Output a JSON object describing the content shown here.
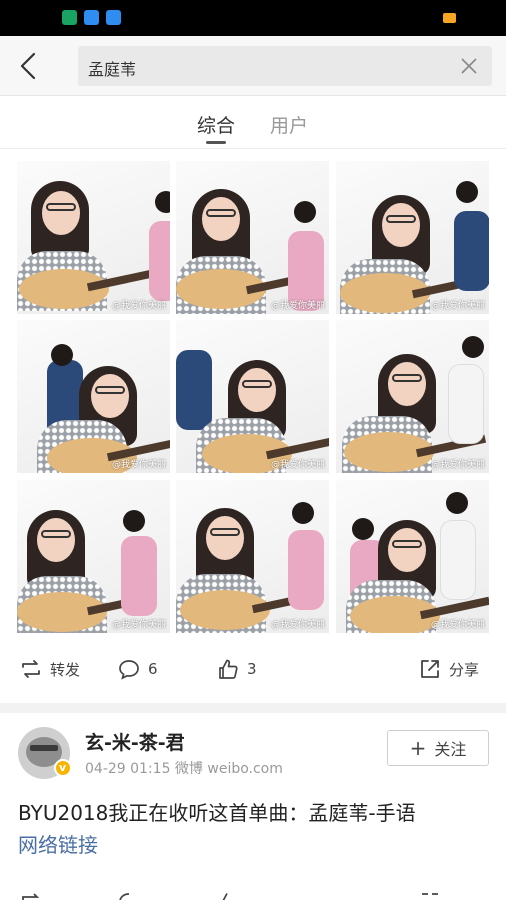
{
  "search": {
    "query": "孟庭苇"
  },
  "tabs": [
    {
      "label": "综合",
      "active": true
    },
    {
      "label": "用户",
      "active": false
    }
  ],
  "photos": [
    {
      "watermark": "@我爱你美丽"
    },
    {
      "watermark": "@我爱你美丽"
    },
    {
      "watermark": "@我爱你美丽"
    },
    {
      "watermark": "@我爱你美丽"
    },
    {
      "watermark": "@我爱你美丽"
    },
    {
      "watermark": "@我爱你美丽"
    },
    {
      "watermark": "@我爱你美丽"
    },
    {
      "watermark": "@我爱你美丽"
    },
    {
      "watermark": "@我爱你美丽"
    }
  ],
  "actions": {
    "repost_label": "转发",
    "comment_count": "6",
    "like_count": "3",
    "share_label": "分享"
  },
  "post": {
    "username": "玄-米-茶-君",
    "meta": "04-29 01:15 微博 weibo.com",
    "follow_label": "关注",
    "text": "BYU2018我正在收听这首单曲：孟庭苇-手语",
    "link": "网络链接"
  },
  "colors": {
    "link": "#4a6fa5",
    "verified_badge": "#f8b500",
    "statusbar": "#000000"
  }
}
